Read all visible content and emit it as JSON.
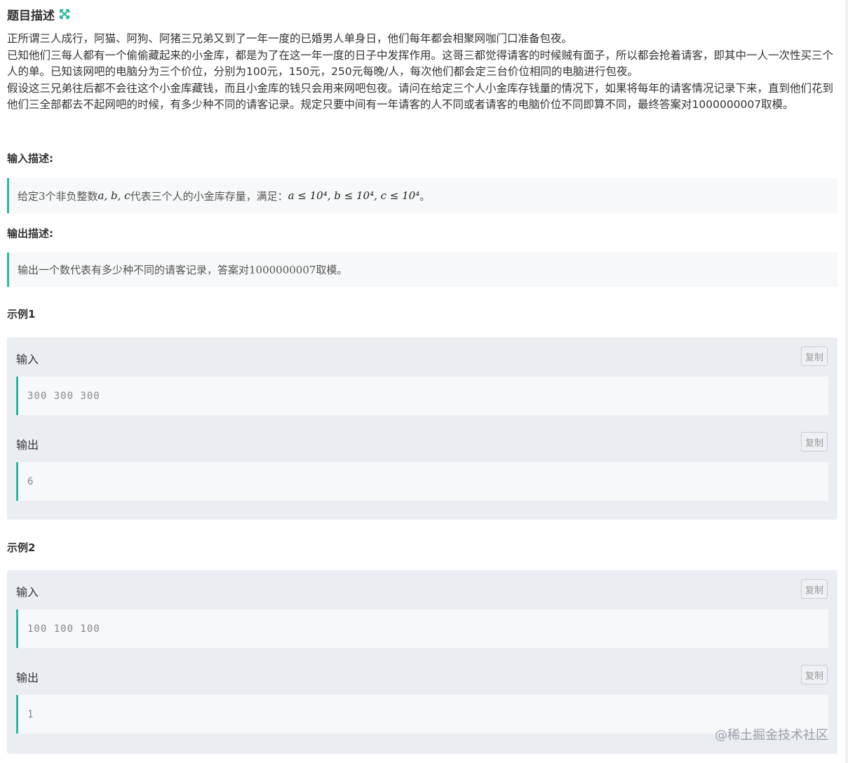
{
  "title": "题目描述",
  "description": [
    "正所谓三人成行，阿猫、阿狗、阿猪三兄弟又到了一年一度的已婚男人单身日，他们每年都会相聚网咖门口准备包夜。",
    "已知他们三每人都有一个偷偷藏起来的小金库，都是为了在这一年一度的日子中发挥作用。这哥三都觉得请客的时候贼有面子，所以都会抢着请客，即其中一人一次性买三个人的单。已知该网吧的电脑分为三个价位，分别为100元，150元，250元每晚/人，每次他们都会定三台价位相同的电脑进行包夜。",
    "假设这三兄弟往后都不会往这个小金库藏钱，而且小金库的钱只会用来网吧包夜。请问在给定三个人小金库存钱量的情况下，如果将每年的请客情况记录下来，直到他们花到他们三全部都去不起网吧的时候，有多少种不同的请客记录。规定只要中间有一年请客的人不同或者请客的电脑价位不同即算不同，最终答案对1000000007取模。"
  ],
  "input_title": "输入描述:",
  "input_desc": {
    "prefix": "给定3个非负整数",
    "vars": "a, b, c",
    "middle": "代表三个人的小金库存量，满足：",
    "constraint": "a ≤ 10⁴, b ≤ 10⁴, c ≤ 10⁴",
    "suffix": "。"
  },
  "output_title": "输出描述:",
  "output_desc": "输出一个数代表有多少种不同的请客记录，答案对1000000007取模。",
  "examples": [
    {
      "title": "示例1",
      "input_label": "输入",
      "input": "300 300 300",
      "output_label": "输出",
      "output": "6",
      "copy_label": "复制"
    },
    {
      "title": "示例2",
      "input_label": "输入",
      "input": "100 100 100",
      "output_label": "输出",
      "output": "1",
      "copy_label": "复制"
    }
  ],
  "watermark": "@稀土掘金技术社区",
  "colors": {
    "accent": "#25bb9b",
    "example_bg": "#eaeef3",
    "code_bg": "#f7f8fa"
  }
}
